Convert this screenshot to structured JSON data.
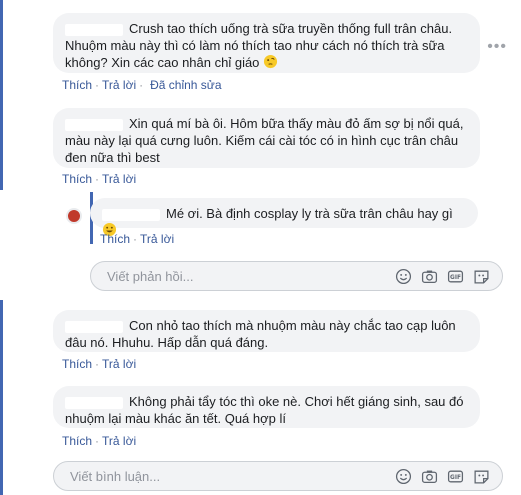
{
  "comments": [
    {
      "text": "Crush tao thích uống trà sữa truyền thống full trân châu. Nhuộm màu này thì có làm nó thích tao như cách nó thích trà sữa không? Xin các cao nhân chỉ giáo",
      "like": "Thích",
      "reply": "Trả lời",
      "edited": "Đã chỉnh sửa"
    },
    {
      "text": "Xin quá mí bà ôi. Hôm bữa thấy màu đỏ ấm sợ bị nổi quá, màu này lại quá cưng luôn. Kiếm cái cài tóc có in hình cục trân châu đen nữa thì best",
      "like": "Thích",
      "reply": "Trả lời"
    },
    {
      "text": "Mé ơi. Bà định cosplay ly trà sữa trân châu hay gì",
      "like": "Thích",
      "reply": "Trả lời"
    },
    {
      "text": "Con nhỏ tao thích mà nhuộm màu này chắc tao cạp luôn đâu nó. Hhuhu. Hấp dẫn quá đáng.",
      "like": "Thích",
      "reply": "Trả lời"
    },
    {
      "text": "Không phải tẩy tóc thì oke nè. Chơi hết giáng sinh, sau đó nhuộm lại màu khác ăn tết. Quá hợp lí",
      "like": "Thích",
      "reply": "Trả lời"
    }
  ],
  "reply_input": {
    "placeholder": "Viết phản hồi..."
  },
  "comment_input": {
    "placeholder": "Viết bình luận..."
  },
  "icons": [
    "emoji-icon",
    "camera-icon",
    "gif-icon",
    "sticker-icon"
  ],
  "colors": {
    "bubble": "#f2f3f5",
    "link": "#385898",
    "accent": "#4267b2"
  }
}
